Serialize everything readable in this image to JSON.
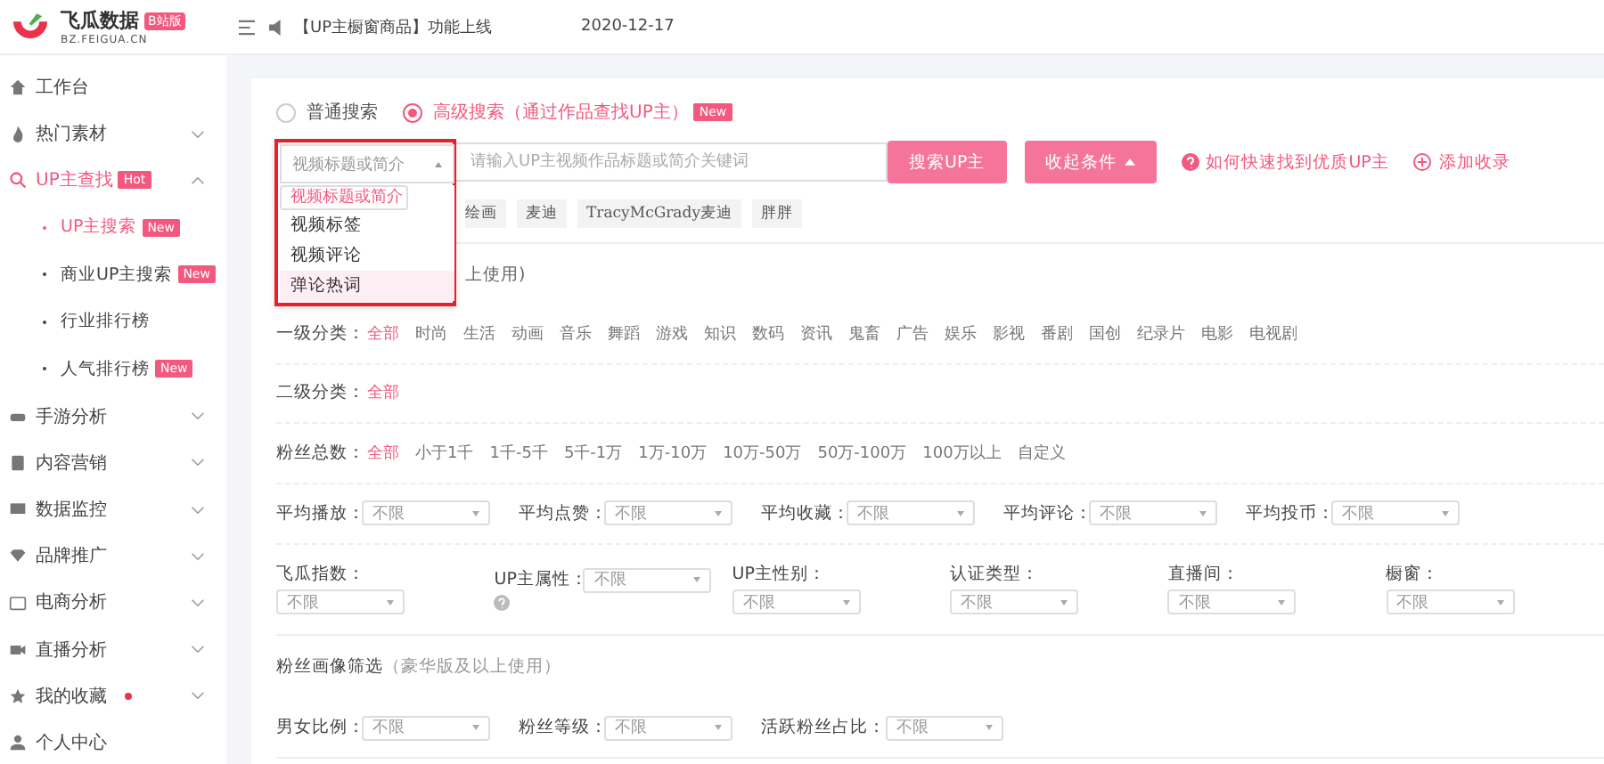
{
  "header": {
    "brand": "飞瓜数据",
    "edition": "B站版",
    "domain": "BZ.FEIGUA.CN",
    "notice": "【UP主橱窗商品】功能上线",
    "date": "2020-12-17"
  },
  "sidebar": {
    "items": [
      {
        "label": "工作台",
        "selected": false
      },
      {
        "label": "热门素材",
        "expanded": false,
        "selected": false
      },
      {
        "label": "UP主查找",
        "badge": "Hot",
        "expanded": true,
        "selected": true,
        "children": [
          {
            "label": "UP主搜索",
            "badge": "New",
            "selected": true
          },
          {
            "label": "商业UP主搜索",
            "badge": "New",
            "selected": false
          },
          {
            "label": "行业排行榜",
            "selected": false
          },
          {
            "label": "人气排行榜",
            "badge": "New",
            "selected": false
          }
        ]
      },
      {
        "label": "手游分析",
        "expanded": false,
        "selected": false
      },
      {
        "label": "内容营销",
        "expanded": false,
        "selected": false
      },
      {
        "label": "数据监控",
        "expanded": false,
        "selected": false
      },
      {
        "label": "品牌推广",
        "expanded": false,
        "selected": false
      },
      {
        "label": "电商分析",
        "expanded": false,
        "selected": false
      },
      {
        "label": "直播分析",
        "expanded": false,
        "selected": false
      },
      {
        "label": "我的收藏",
        "dot": true,
        "expanded": false,
        "selected": false
      },
      {
        "label": "个人中心",
        "selected": false
      }
    ]
  },
  "search_modes": [
    {
      "label": "普通搜索",
      "selected": false
    },
    {
      "label": "高级搜索（通过作品查找UP主）",
      "badge": "New",
      "selected": true
    }
  ],
  "search": {
    "field_select": "视频标题或简介",
    "placeholder": "请输入UP主视频作品标题或简介关键词",
    "button": "搜索UP主",
    "collapse": "收起条件",
    "help_link": "如何快速找到优质UP主",
    "add_link": "添加收录"
  },
  "dropdown": {
    "options": [
      {
        "label": "视频标题或简介",
        "selected": true,
        "hovered": false
      },
      {
        "label": "视频标签",
        "selected": false,
        "hovered": false
      },
      {
        "label": "视频评论",
        "selected": false,
        "hovered": false
      },
      {
        "label": "弹论热词",
        "selected": false,
        "hovered": true
      }
    ]
  },
  "tags": [
    "绘画",
    "麦迪",
    "TracyMcGrady麦迪",
    "胖胖"
  ],
  "hint_fragment": "上使用)",
  "option_rows": [
    {
      "label": "一级分类：",
      "options": [
        {
          "label": "全部",
          "selected": true
        },
        {
          "label": "时尚",
          "selected": false
        },
        {
          "label": "生活",
          "selected": false
        },
        {
          "label": "动画",
          "selected": false
        },
        {
          "label": "音乐",
          "selected": false
        },
        {
          "label": "舞蹈",
          "selected": false
        },
        {
          "label": "游戏",
          "selected": false
        },
        {
          "label": "知识",
          "selected": false
        },
        {
          "label": "数码",
          "selected": false
        },
        {
          "label": "资讯",
          "selected": false
        },
        {
          "label": "鬼畜",
          "selected": false
        },
        {
          "label": "广告",
          "selected": false
        },
        {
          "label": "娱乐",
          "selected": false
        },
        {
          "label": "影视",
          "selected": false
        },
        {
          "label": "番剧",
          "selected": false
        },
        {
          "label": "国创",
          "selected": false
        },
        {
          "label": "纪录片",
          "selected": false
        },
        {
          "label": "电影",
          "selected": false
        },
        {
          "label": "电视剧",
          "selected": false
        }
      ]
    },
    {
      "label": "二级分类：",
      "options": [
        {
          "label": "全部",
          "selected": true
        }
      ]
    },
    {
      "label": "粉丝总数：",
      "options": [
        {
          "label": "全部",
          "selected": true
        },
        {
          "label": "小于1千",
          "selected": false
        },
        {
          "label": "1千-5千",
          "selected": false
        },
        {
          "label": "5千-1万",
          "selected": false
        },
        {
          "label": "1万-10万",
          "selected": false
        },
        {
          "label": "10万-50万",
          "selected": false
        },
        {
          "label": "50万-100万",
          "selected": false
        },
        {
          "label": "100万以上",
          "selected": false
        },
        {
          "label": "自定义",
          "selected": false
        }
      ]
    }
  ],
  "filters_row1": [
    {
      "label": "平均播放：",
      "value": "不限"
    },
    {
      "label": "平均点赞：",
      "value": "不限"
    },
    {
      "label": "平均收藏：",
      "value": "不限"
    },
    {
      "label": "平均评论：",
      "value": "不限"
    },
    {
      "label": "平均投币：",
      "value": "不限"
    }
  ],
  "filters_row2": [
    {
      "label": "飞瓜指数：",
      "value": "不限",
      "kind": "stacked"
    },
    {
      "label": "UP主属性：",
      "value": "不限",
      "kind": "inline-help"
    },
    {
      "label": "UP主性别：",
      "value": "不限",
      "kind": "stacked"
    },
    {
      "label": "认证类型：",
      "value": "不限",
      "kind": "stacked"
    },
    {
      "label": "直播间：",
      "value": "不限",
      "kind": "stacked"
    },
    {
      "label": "橱窗：",
      "value": "不限",
      "kind": "stacked"
    }
  ],
  "portrait": {
    "title": "粉丝画像筛选",
    "note": "（豪华版及以上使用）",
    "filters": [
      {
        "label": "男女比例：",
        "value": "不限"
      },
      {
        "label": "粉丝等级：",
        "value": "不限"
      },
      {
        "label": "活跃粉丝占比：",
        "value": "不限"
      }
    ]
  }
}
